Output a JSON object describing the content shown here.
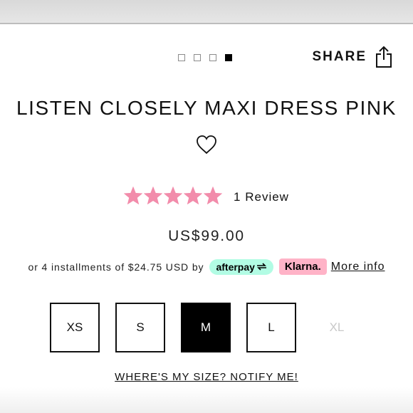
{
  "gallery": {
    "count": 4,
    "active_index": 3
  },
  "share": {
    "label": "SHARE",
    "icon": "share-icon"
  },
  "product": {
    "title": "LISTEN CLOSELY MAXI DRESS PINK",
    "wishlist_icon": "heart-icon",
    "rating": 5,
    "rating_max": 5,
    "review_label": "1 Review",
    "price": "US$99.00"
  },
  "installments": {
    "text": "or 4 installments of $24.75 USD by",
    "afterpay_label": "afterpay",
    "klarna_label": "Klarna.",
    "more_info": "More info"
  },
  "sizes": [
    {
      "label": "XS",
      "state": "available"
    },
    {
      "label": "S",
      "state": "available"
    },
    {
      "label": "M",
      "state": "selected"
    },
    {
      "label": "L",
      "state": "available"
    },
    {
      "label": "XL",
      "state": "unavailable"
    }
  ],
  "notify_label": "WHERE'S MY SIZE? NOTIFY ME!",
  "colors": {
    "star": "#f28cab",
    "afterpay_bg": "#b2fce4",
    "klarna_bg": "#ffb3c7",
    "selected_bg": "#000000"
  }
}
